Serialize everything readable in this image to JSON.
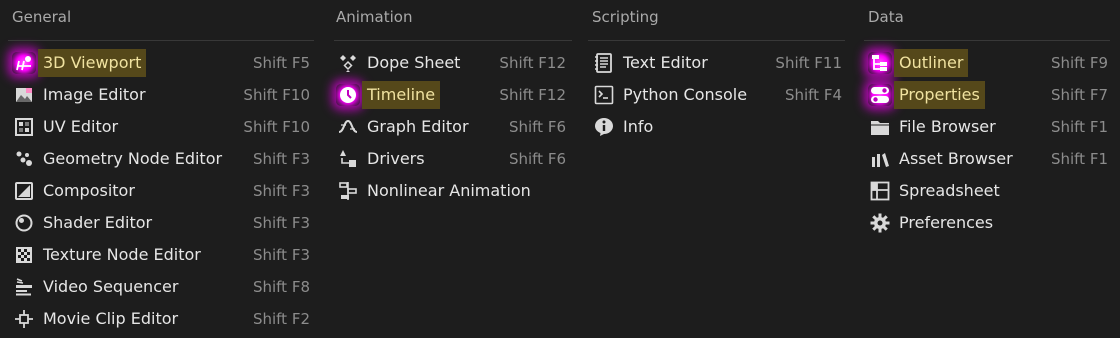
{
  "columns": [
    {
      "header": "General",
      "items": [
        {
          "label": "3D Viewport",
          "shortcut": "Shift F5",
          "icon": "3d-viewport-icon",
          "highlighted": true,
          "glow": true
        },
        {
          "label": "Image Editor",
          "shortcut": "Shift F10",
          "icon": "image-editor-icon"
        },
        {
          "label": "UV Editor",
          "shortcut": "Shift F10",
          "icon": "uv-editor-icon"
        },
        {
          "label": "Geometry Node Editor",
          "shortcut": "Shift F3",
          "icon": "geometry-nodes-icon"
        },
        {
          "label": "Compositor",
          "shortcut": "Shift F3",
          "icon": "compositor-icon"
        },
        {
          "label": "Shader Editor",
          "shortcut": "Shift F3",
          "icon": "shader-editor-icon"
        },
        {
          "label": "Texture Node Editor",
          "shortcut": "Shift F3",
          "icon": "texture-node-icon"
        },
        {
          "label": "Video Sequencer",
          "shortcut": "Shift F8",
          "icon": "video-sequencer-icon"
        },
        {
          "label": "Movie Clip Editor",
          "shortcut": "Shift F2",
          "icon": "movie-clip-icon"
        }
      ]
    },
    {
      "header": "Animation",
      "items": [
        {
          "label": "Dope Sheet",
          "shortcut": "Shift F12",
          "icon": "dope-sheet-icon"
        },
        {
          "label": "Timeline",
          "shortcut": "Shift F12",
          "icon": "timeline-icon",
          "highlighted": true,
          "glow": true
        },
        {
          "label": "Graph Editor",
          "shortcut": "Shift F6",
          "icon": "graph-editor-icon"
        },
        {
          "label": "Drivers",
          "shortcut": "Shift F6",
          "icon": "drivers-icon"
        },
        {
          "label": "Nonlinear Animation",
          "shortcut": "",
          "icon": "nonlinear-animation-icon"
        }
      ]
    },
    {
      "header": "Scripting",
      "items": [
        {
          "label": "Text Editor",
          "shortcut": "Shift F11",
          "icon": "text-editor-icon"
        },
        {
          "label": "Python Console",
          "shortcut": "Shift F4",
          "icon": "python-console-icon"
        },
        {
          "label": "Info",
          "shortcut": "",
          "icon": "info-icon"
        }
      ]
    },
    {
      "header": "Data",
      "items": [
        {
          "label": "Outliner",
          "shortcut": "Shift F9",
          "icon": "outliner-icon",
          "highlighted": true,
          "glow": true
        },
        {
          "label": "Properties",
          "shortcut": "Shift F7",
          "icon": "properties-icon",
          "highlighted": true,
          "glow": true
        },
        {
          "label": "File Browser",
          "shortcut": "Shift F1",
          "icon": "file-browser-icon"
        },
        {
          "label": "Asset Browser",
          "shortcut": "Shift F1",
          "icon": "asset-browser-icon"
        },
        {
          "label": "Spreadsheet",
          "shortcut": "",
          "icon": "spreadsheet-icon"
        },
        {
          "label": "Preferences",
          "shortcut": "",
          "icon": "gear-icon"
        }
      ]
    }
  ]
}
